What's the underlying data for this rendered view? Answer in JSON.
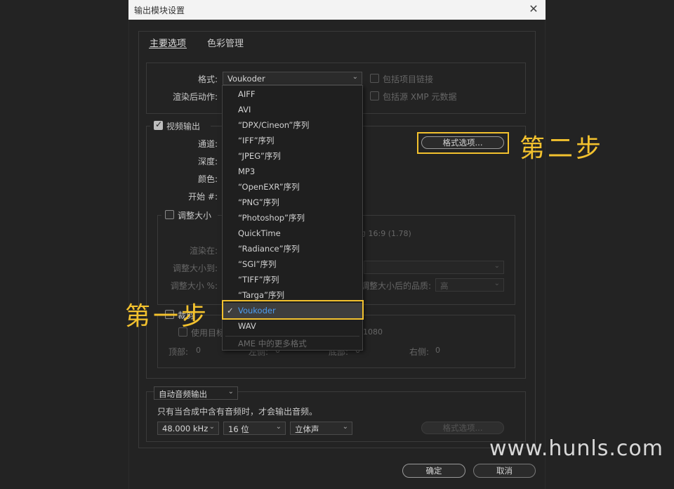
{
  "window": {
    "title": "输出模块设置",
    "close_glyph": "✕"
  },
  "tabs": [
    {
      "label": "主要选项",
      "active": true
    },
    {
      "label": "色彩管理",
      "active": false
    }
  ],
  "format_section": {
    "format_label": "格式:",
    "format_value": "Voukoder",
    "post_render_label": "渲染后动作:",
    "include_project_link": "包括项目链接",
    "include_xmp": "包括源 XMP 元数据"
  },
  "video": {
    "output_label": "视频输出",
    "channels_label": "通道:",
    "depth_label": "深度:",
    "color_label": "颜色:",
    "start_label": "开始 #:",
    "format_options_button": "格式选项..."
  },
  "resize": {
    "label": "调整大小",
    "aspect_text": "为 16:9 (1.78)",
    "render_at_label": "渲染在:",
    "resize_to_label": "调整大小到:",
    "resize_pct_label": "调整大小 %:",
    "quality_label": "调整大小后的品质:",
    "quality_value": "高"
  },
  "crop": {
    "label": "裁剪",
    "use_roi_label": "使用目标区域",
    "size_text": "1080",
    "top_label": "顶部:",
    "top_value": "0",
    "left_label": "左侧:",
    "left_value": "0",
    "bottom_label": "底部:",
    "bottom_value": "0",
    "right_label": "右侧:",
    "right_value": "0"
  },
  "audio": {
    "mode_value": "自动音频输出",
    "note": "只有当合成中含有音频时，才会输出音频。",
    "rate_value": "48.000 kHz",
    "bits_value": "16 位",
    "channels_value": "立体声",
    "format_options_button": "格式选项..."
  },
  "dropdown": {
    "items": [
      "AIFF",
      "AVI",
      "“DPX/Cineon”序列",
      "“IFF”序列",
      "“JPEG”序列",
      "MP3",
      "“OpenEXR”序列",
      "“PNG”序列",
      "“Photoshop”序列",
      "QuickTime",
      "“Radiance”序列",
      "“SGI”序列",
      "“TIFF”序列",
      "“Targa”序列",
      "Voukoder",
      "WAV"
    ],
    "selected": "Voukoder",
    "more_formats": "AME 中的更多格式"
  },
  "footer": {
    "ok": "确定",
    "cancel": "取消"
  },
  "annotations": {
    "step1": "第一步",
    "step2": "第二步"
  },
  "watermark": "www.hunls.com",
  "colors": {
    "highlight": "#f2c12e",
    "selected_text": "#4d9df0"
  }
}
